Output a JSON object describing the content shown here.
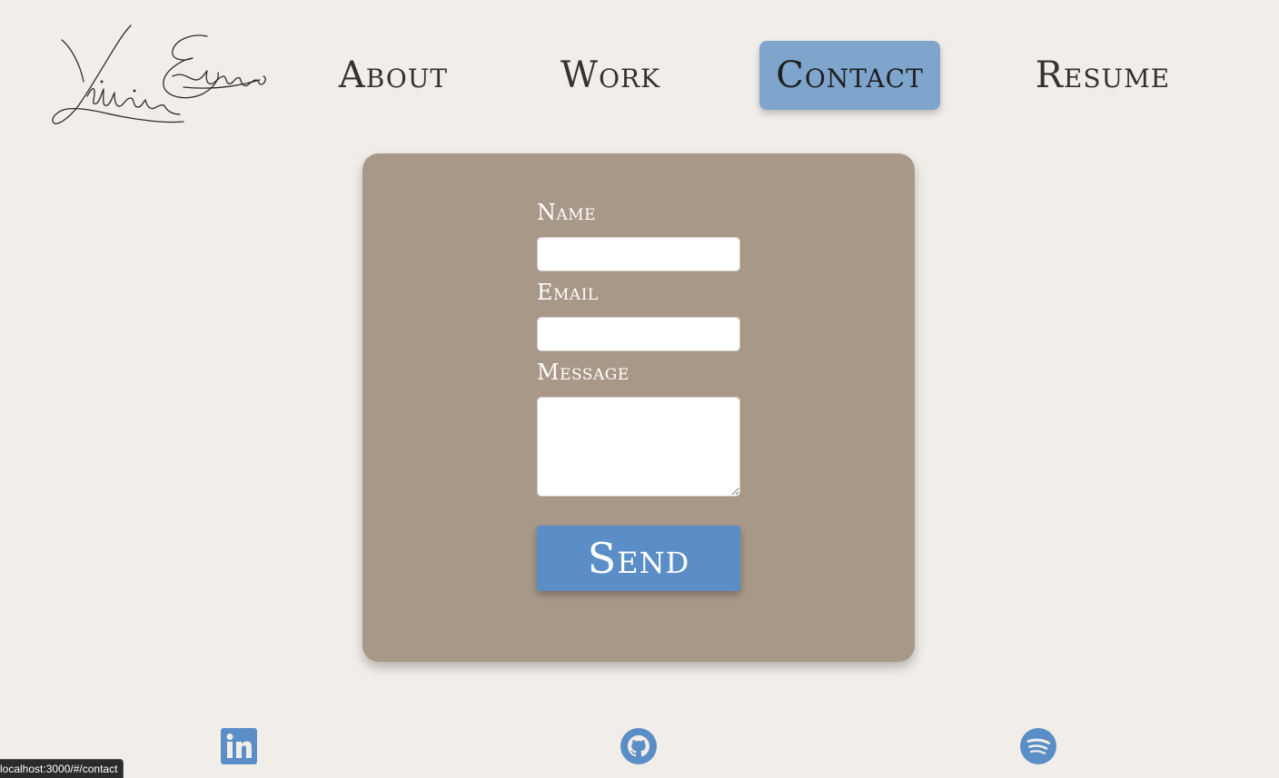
{
  "header": {
    "logo": {
      "text": "Lillian Edwards",
      "style": "handwritten-signature"
    },
    "nav": [
      {
        "label": "About",
        "active": false
      },
      {
        "label": "Work",
        "active": false
      },
      {
        "label": "Contact",
        "active": true
      },
      {
        "label": "Resume",
        "active": false
      }
    ]
  },
  "contact_form": {
    "fields": [
      {
        "label": "Name",
        "value": "",
        "type": "text"
      },
      {
        "label": "Email",
        "value": "",
        "type": "text"
      },
      {
        "label": "Message",
        "value": "",
        "type": "textarea"
      }
    ],
    "send_label": "Send"
  },
  "footer": {
    "social": [
      {
        "icon": "linkedin-icon"
      },
      {
        "icon": "github-icon"
      },
      {
        "icon": "spotify-icon"
      }
    ]
  },
  "status_bar": {
    "url": "localhost:3000/#/contact"
  },
  "colors": {
    "page_background": "#f1eeea",
    "card_background": "#a89888",
    "accent": "#5b8ec6",
    "active_nav": "#7fa5cd"
  }
}
